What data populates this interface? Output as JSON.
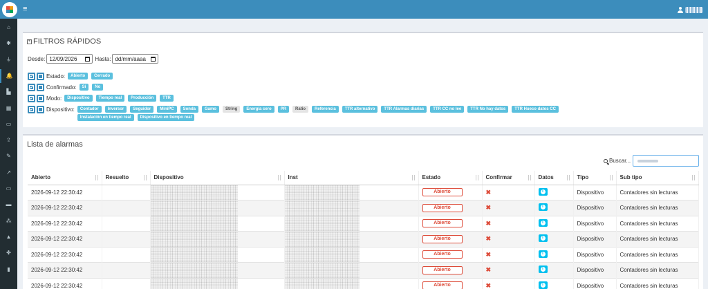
{
  "topbar": {
    "menu_icon": "hamburger-icon",
    "user_icon": "user-icon",
    "brand_color": "#3c8dbc"
  },
  "sidebar": {
    "items": [
      {
        "icon": "home-icon",
        "glyph": "⌂"
      },
      {
        "icon": "gear-icon",
        "glyph": "✱"
      },
      {
        "icon": "plug-icon",
        "glyph": "⏚"
      },
      {
        "icon": "bell-icon",
        "glyph": "🔔"
      },
      {
        "icon": "chart-bar-icon",
        "glyph": "▙"
      },
      {
        "icon": "map-icon",
        "glyph": "▦"
      },
      {
        "icon": "monitor-icon",
        "glyph": "▭"
      },
      {
        "icon": "upload-icon",
        "glyph": "⇪"
      },
      {
        "icon": "wrench-icon",
        "glyph": "✎"
      },
      {
        "icon": "line-chart-icon",
        "glyph": "↗"
      },
      {
        "icon": "battery-icon",
        "glyph": "▭"
      },
      {
        "icon": "server-icon",
        "glyph": "▬"
      },
      {
        "icon": "cubes-icon",
        "glyph": "⁂"
      },
      {
        "icon": "warning-icon",
        "glyph": "▲"
      },
      {
        "icon": "puzzle-icon",
        "glyph": "✤"
      },
      {
        "icon": "file-icon",
        "glyph": "▮"
      }
    ]
  },
  "filters": {
    "title": "FILTROS RÁPIDOS",
    "desde_label": "Desde:",
    "desde_value": "12/09/2026",
    "hasta_label": "Hasta:",
    "hasta_value": "dd/mm/aaaa",
    "estado": {
      "label": "Estado:",
      "tags": [
        {
          "text": "Abierto",
          "active": true
        },
        {
          "text": "Cerrado",
          "active": true
        }
      ]
    },
    "confirmado": {
      "label": "Confirmado:",
      "tags": [
        {
          "text": "Sí",
          "active": true
        },
        {
          "text": "No",
          "active": true
        }
      ]
    },
    "modo": {
      "label": "Modo:",
      "tags": [
        {
          "text": "Dispositivo",
          "active": true
        },
        {
          "text": "Tiempo real",
          "active": true
        },
        {
          "text": "Producción",
          "active": true
        },
        {
          "text": "TTR",
          "active": true
        }
      ]
    },
    "dispositivo": {
      "label": "Dispositivo:",
      "tags": [
        {
          "text": "Contador",
          "active": true
        },
        {
          "text": "Inversor",
          "active": true
        },
        {
          "text": "Seguidor",
          "active": true
        },
        {
          "text": "MiniPC",
          "active": true
        },
        {
          "text": "Sonda",
          "active": true
        },
        {
          "text": "Gamo",
          "active": true
        },
        {
          "text": "String",
          "active": false
        },
        {
          "text": "Energía cero",
          "active": true
        },
        {
          "text": "PR",
          "active": true
        },
        {
          "text": "Ratio",
          "active": false
        },
        {
          "text": "Referencia",
          "active": true
        },
        {
          "text": "TTR alternativo",
          "active": true
        },
        {
          "text": "TTR Alarmas diarias",
          "active": true
        },
        {
          "text": "TTR CC no lee",
          "active": true
        },
        {
          "text": "TTR No hay datos",
          "active": true
        },
        {
          "text": "TTR Hueco datos CC",
          "active": true
        },
        {
          "text": "Instalación en tiempo real",
          "active": true
        },
        {
          "text": "Dispositivo en tiempo real",
          "active": true
        }
      ]
    }
  },
  "alarms": {
    "title": "Lista de alarmas",
    "search_label": "Buscar...",
    "columns": [
      "Abierto",
      "Resuelto",
      "Dispositivo",
      "Inst",
      "Estado",
      "Confirmar",
      "Datos",
      "Tipo",
      "Sub tipo"
    ],
    "rows": [
      {
        "abierto": "2026-09-12 22:30:42",
        "resuelto": "",
        "estado": "Abierto",
        "tipo": "Dispositivo",
        "subtipo": "Contadores sin lecturas"
      },
      {
        "abierto": "2026-09-12 22:30:42",
        "resuelto": "",
        "estado": "Abierto",
        "tipo": "Dispositivo",
        "subtipo": "Contadores sin lecturas"
      },
      {
        "abierto": "2026-09-12 22:30:42",
        "resuelto": "",
        "estado": "Abierto",
        "tipo": "Dispositivo",
        "subtipo": "Contadores sin lecturas"
      },
      {
        "abierto": "2026-09-12 22:30:42",
        "resuelto": "",
        "estado": "Abierto",
        "tipo": "Dispositivo",
        "subtipo": "Contadores sin lecturas"
      },
      {
        "abierto": "2026-09-12 22:30:42",
        "resuelto": "",
        "estado": "Abierto",
        "tipo": "Dispositivo",
        "subtipo": "Contadores sin lecturas"
      },
      {
        "abierto": "2026-09-12 22:30:42",
        "resuelto": "",
        "estado": "Abierto",
        "tipo": "Dispositivo",
        "subtipo": "Contadores sin lecturas"
      },
      {
        "abierto": "2026-09-12 22:30:42",
        "resuelto": "",
        "estado": "Abierto",
        "tipo": "Dispositivo",
        "subtipo": "Contadores sin lecturas"
      }
    ],
    "confirm_icon": "close-icon",
    "datos_icon": "info-icon",
    "status_color": "#dd4b39",
    "info_color": "#00c0ef"
  }
}
